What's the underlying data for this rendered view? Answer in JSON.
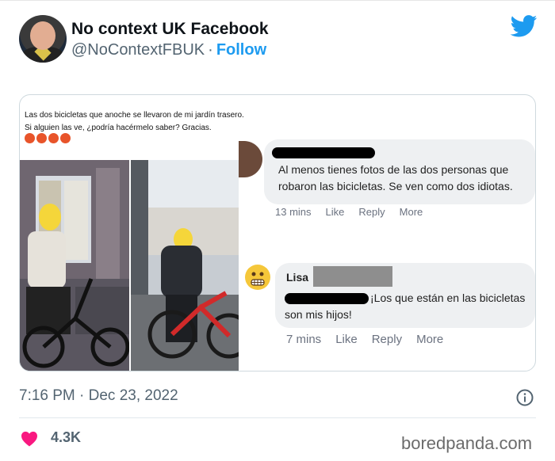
{
  "account": {
    "name": "No context UK Facebook",
    "handle": "@NoContextFBUK",
    "separator": "·",
    "follow_label": "Follow"
  },
  "icons": {
    "brand": "twitter-bird-icon",
    "info": "info-icon",
    "like": "heart-icon",
    "brand_color": "#1d9bf0",
    "heart_color": "#f91880"
  },
  "media": {
    "post": {
      "line1": "Las dos bicicletas que anoche se llevaron de mi jardín trasero.",
      "line2": "Si alguien las ve, ¿podría hacérmelo saber? Gracias."
    },
    "comment1": {
      "text_line1": "Al menos tienes fotos de las dos personas que",
      "text_line2": "robaron las bicicletas. Se ven como dos idiotas.",
      "time": "13 mins",
      "like": "Like",
      "reply": "Reply",
      "more": "More"
    },
    "comment2": {
      "author": "Lisa",
      "text_line1": "¡Los que están en las bicicletas",
      "text_line2": "son mis hijos!",
      "time": "7 mins",
      "like": "Like",
      "reply": "Reply",
      "more": "More"
    }
  },
  "footer": {
    "timestamp": "7:16 PM · Dec 23, 2022",
    "likes": "4.3K"
  },
  "watermark": "boredpanda.com"
}
